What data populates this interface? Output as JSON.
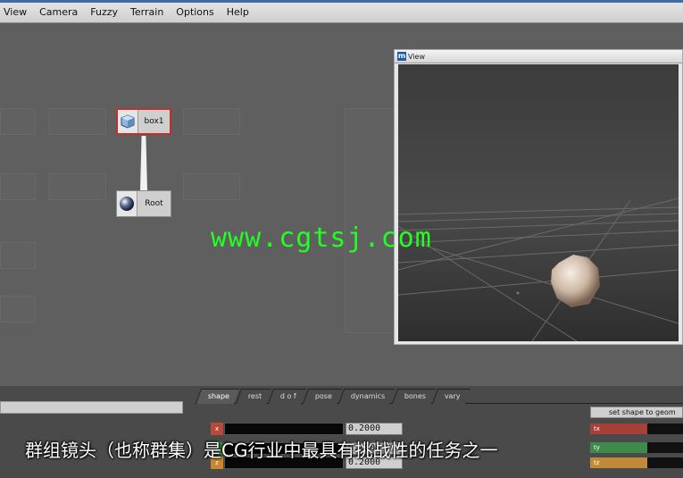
{
  "menu": [
    "View",
    "Camera",
    "Fuzzy",
    "Terrain",
    "Options",
    "Help"
  ],
  "nodes": {
    "box1": "box1",
    "root": "Root"
  },
  "view_window": {
    "title": "View"
  },
  "watermark": "www.cgtsj.com",
  "tabs": [
    "shape",
    "rest",
    "d o f",
    "pose",
    "dynamics",
    "bones",
    "vary"
  ],
  "attributes": [
    {
      "label": "x",
      "value": "0.2000",
      "color": "#b84a3a"
    },
    {
      "label": "y",
      "value": "0.2000",
      "color": "#3c8a3c"
    },
    {
      "label": "z",
      "value": "0.2000",
      "color": "#c8872e"
    }
  ],
  "set_shape_button": "set shape to geom",
  "channels": [
    {
      "label": "tx",
      "color": "#a8403a"
    },
    {
      "label": "ty",
      "color": "#3e8a4a"
    },
    {
      "label": "tz",
      "color": "#c08a38"
    }
  ],
  "subtitle": "群组镜头（也称群集）是CG行业中最具有挑战性的任务之一"
}
